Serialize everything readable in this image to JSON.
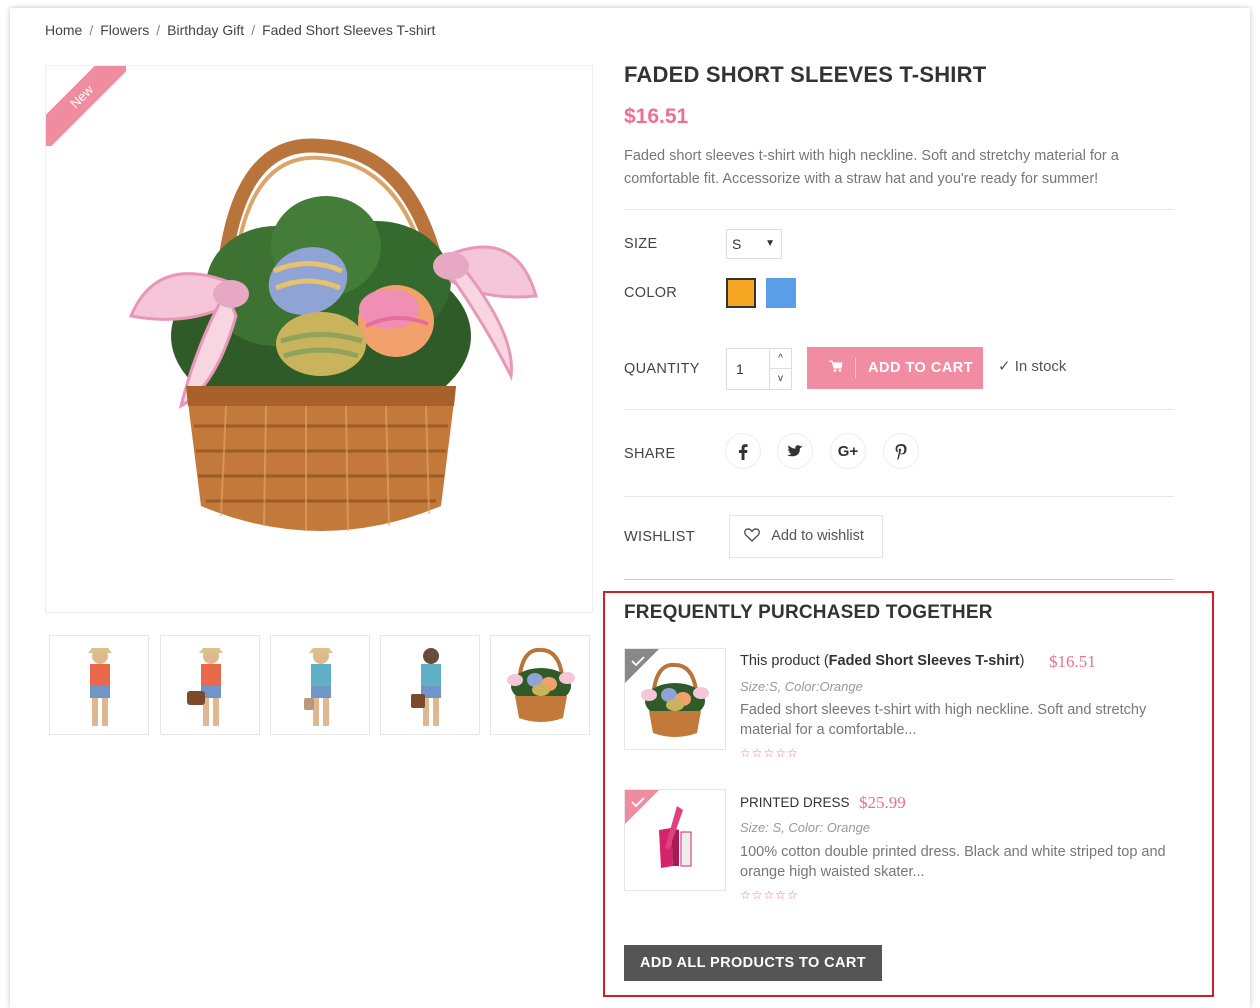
{
  "breadcrumb": {
    "items": [
      "Home",
      "Flowers",
      "Birthday Gift",
      "Faded Short Sleeves T-shirt"
    ],
    "separator": "/"
  },
  "gallery": {
    "badge": "New",
    "main_image": "gift-basket-with-easter-eggs",
    "thumbnails": [
      "woman-in-tshirt-1",
      "woman-with-bag",
      "woman-in-blue-top",
      "woman-with-handbag",
      "gift-basket"
    ]
  },
  "product": {
    "title": "FADED SHORT SLEEVES T-SHIRT",
    "price": "$16.51",
    "description": "Faded short sleeves t-shirt with high neckline. Soft and stretchy material for a comfortable fit. Accessorize with a straw hat and you're ready for summer!",
    "size_label": "SIZE",
    "size_value": "S",
    "color_label": "COLOR",
    "colors": [
      {
        "name": "orange",
        "hex": "#f5a623",
        "selected": true
      },
      {
        "name": "blue",
        "hex": "#5b9ee8",
        "selected": false
      }
    ],
    "quantity_label": "QUANTITY",
    "quantity_value": "1",
    "add_to_cart": "ADD TO CART",
    "stock": "In stock",
    "share_label": "SHARE",
    "share_icons": [
      "facebook-icon",
      "twitter-icon",
      "google-plus-icon",
      "pinterest-icon"
    ],
    "share_glyphs": [
      "f",
      "🐦",
      "G+",
      "P"
    ],
    "wishlist_label": "WISHLIST",
    "wishlist_button": "Add to wishlist"
  },
  "frequently_purchased": {
    "title": "FREQUENTLY PURCHASED TOGETHER",
    "items": [
      {
        "prefix": "This product (",
        "name": "Faded Short Sleeves T-shirt",
        "suffix": ")",
        "price": "$16.51",
        "attrs": "Size:S, Color:Orange",
        "desc": "Faded short sleeves t-shirt with high neckline. Soft and stretchy material for a comfortable...",
        "stars": "☆☆☆☆☆",
        "checked": true
      },
      {
        "name": "PRINTED DRESS",
        "price": "$25.99",
        "attrs": "Size: S, Color: Orange",
        "desc": "100% cotton double printed dress. Black and white striped top and orange high waisted skater...",
        "stars": "☆☆☆☆☆",
        "checked": true
      }
    ],
    "add_all_button": "ADD ALL PRODUCTS TO CART"
  },
  "colors": {
    "accent": "#ef6f8c",
    "button_pink": "#f28ca2",
    "highlight_border": "#cf2027",
    "dark_button": "#555555"
  }
}
